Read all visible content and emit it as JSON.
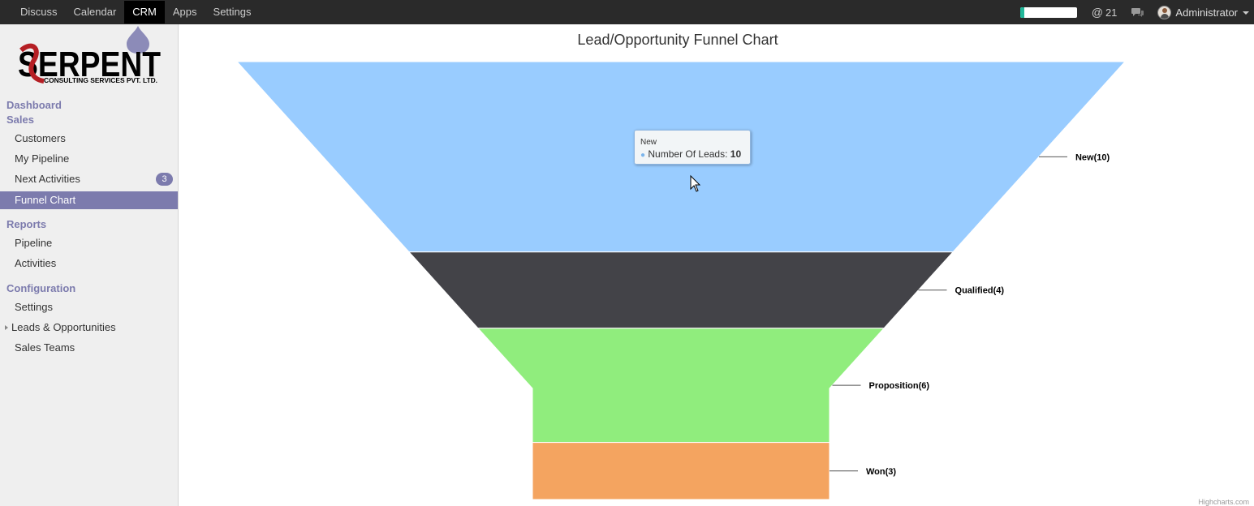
{
  "topbar": {
    "menu": [
      "Discuss",
      "Calendar",
      "CRM",
      "Apps",
      "Settings"
    ],
    "active": "CRM",
    "mentions": "21",
    "user": "Administrator",
    "progress": 0.08
  },
  "sidebar": {
    "logo_text": "SERPENT",
    "logo_subtext": "CONSULTING SERVICES PVT. LTD.",
    "dashboard": "Dashboard",
    "sales": "Sales",
    "sales_items": [
      "Customers",
      "My Pipeline",
      "Next Activities",
      "Funnel Chart"
    ],
    "next_activities_count": "3",
    "reports": "Reports",
    "report_items": [
      "Pipeline",
      "Activities"
    ],
    "configuration": "Configuration",
    "config_items": [
      "Settings",
      "Leads & Opportunities",
      "Sales Teams"
    ]
  },
  "chart_data": {
    "type": "funnel",
    "title": "Lead/Opportunity Funnel Chart",
    "series_name": "Number Of Leads",
    "stages": [
      {
        "name": "New",
        "value": 10,
        "label": "New(10)",
        "color": "#99ccff"
      },
      {
        "name": "Qualified",
        "value": 4,
        "label": "Qualified(4)",
        "color": "#434348"
      },
      {
        "name": "Proposition",
        "value": 6,
        "label": "Proposition(6)",
        "color": "#90ed7d"
      },
      {
        "name": "Won",
        "value": 3,
        "label": "Won(3)",
        "color": "#f4a460"
      }
    ],
    "tooltip": {
      "title": "New",
      "series": "Number Of Leads",
      "value": "10"
    },
    "credits": "Highcharts.com"
  }
}
